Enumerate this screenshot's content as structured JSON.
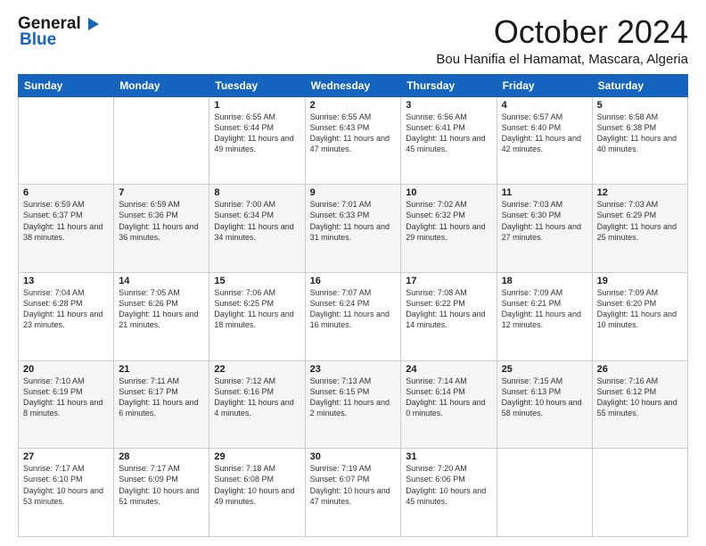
{
  "logo": {
    "general": "General",
    "blue": "Blue"
  },
  "header": {
    "month_title": "October 2024",
    "location": "Bou Hanifia el Hamamat, Mascara, Algeria"
  },
  "days_of_week": [
    "Sunday",
    "Monday",
    "Tuesday",
    "Wednesday",
    "Thursday",
    "Friday",
    "Saturday"
  ],
  "weeks": [
    [
      {
        "day": "",
        "sunrise": "",
        "sunset": "",
        "daylight": ""
      },
      {
        "day": "",
        "sunrise": "",
        "sunset": "",
        "daylight": ""
      },
      {
        "day": "1",
        "sunrise": "Sunrise: 6:55 AM",
        "sunset": "Sunset: 6:44 PM",
        "daylight": "Daylight: 11 hours and 49 minutes."
      },
      {
        "day": "2",
        "sunrise": "Sunrise: 6:55 AM",
        "sunset": "Sunset: 6:43 PM",
        "daylight": "Daylight: 11 hours and 47 minutes."
      },
      {
        "day": "3",
        "sunrise": "Sunrise: 6:56 AM",
        "sunset": "Sunset: 6:41 PM",
        "daylight": "Daylight: 11 hours and 45 minutes."
      },
      {
        "day": "4",
        "sunrise": "Sunrise: 6:57 AM",
        "sunset": "Sunset: 6:40 PM",
        "daylight": "Daylight: 11 hours and 42 minutes."
      },
      {
        "day": "5",
        "sunrise": "Sunrise: 6:58 AM",
        "sunset": "Sunset: 6:38 PM",
        "daylight": "Daylight: 11 hours and 40 minutes."
      }
    ],
    [
      {
        "day": "6",
        "sunrise": "Sunrise: 6:59 AM",
        "sunset": "Sunset: 6:37 PM",
        "daylight": "Daylight: 11 hours and 38 minutes."
      },
      {
        "day": "7",
        "sunrise": "Sunrise: 6:59 AM",
        "sunset": "Sunset: 6:36 PM",
        "daylight": "Daylight: 11 hours and 36 minutes."
      },
      {
        "day": "8",
        "sunrise": "Sunrise: 7:00 AM",
        "sunset": "Sunset: 6:34 PM",
        "daylight": "Daylight: 11 hours and 34 minutes."
      },
      {
        "day": "9",
        "sunrise": "Sunrise: 7:01 AM",
        "sunset": "Sunset: 6:33 PM",
        "daylight": "Daylight: 11 hours and 31 minutes."
      },
      {
        "day": "10",
        "sunrise": "Sunrise: 7:02 AM",
        "sunset": "Sunset: 6:32 PM",
        "daylight": "Daylight: 11 hours and 29 minutes."
      },
      {
        "day": "11",
        "sunrise": "Sunrise: 7:03 AM",
        "sunset": "Sunset: 6:30 PM",
        "daylight": "Daylight: 11 hours and 27 minutes."
      },
      {
        "day": "12",
        "sunrise": "Sunrise: 7:03 AM",
        "sunset": "Sunset: 6:29 PM",
        "daylight": "Daylight: 11 hours and 25 minutes."
      }
    ],
    [
      {
        "day": "13",
        "sunrise": "Sunrise: 7:04 AM",
        "sunset": "Sunset: 6:28 PM",
        "daylight": "Daylight: 11 hours and 23 minutes."
      },
      {
        "day": "14",
        "sunrise": "Sunrise: 7:05 AM",
        "sunset": "Sunset: 6:26 PM",
        "daylight": "Daylight: 11 hours and 21 minutes."
      },
      {
        "day": "15",
        "sunrise": "Sunrise: 7:06 AM",
        "sunset": "Sunset: 6:25 PM",
        "daylight": "Daylight: 11 hours and 18 minutes."
      },
      {
        "day": "16",
        "sunrise": "Sunrise: 7:07 AM",
        "sunset": "Sunset: 6:24 PM",
        "daylight": "Daylight: 11 hours and 16 minutes."
      },
      {
        "day": "17",
        "sunrise": "Sunrise: 7:08 AM",
        "sunset": "Sunset: 6:22 PM",
        "daylight": "Daylight: 11 hours and 14 minutes."
      },
      {
        "day": "18",
        "sunrise": "Sunrise: 7:09 AM",
        "sunset": "Sunset: 6:21 PM",
        "daylight": "Daylight: 11 hours and 12 minutes."
      },
      {
        "day": "19",
        "sunrise": "Sunrise: 7:09 AM",
        "sunset": "Sunset: 6:20 PM",
        "daylight": "Daylight: 11 hours and 10 minutes."
      }
    ],
    [
      {
        "day": "20",
        "sunrise": "Sunrise: 7:10 AM",
        "sunset": "Sunset: 6:19 PM",
        "daylight": "Daylight: 11 hours and 8 minutes."
      },
      {
        "day": "21",
        "sunrise": "Sunrise: 7:11 AM",
        "sunset": "Sunset: 6:17 PM",
        "daylight": "Daylight: 11 hours and 6 minutes."
      },
      {
        "day": "22",
        "sunrise": "Sunrise: 7:12 AM",
        "sunset": "Sunset: 6:16 PM",
        "daylight": "Daylight: 11 hours and 4 minutes."
      },
      {
        "day": "23",
        "sunrise": "Sunrise: 7:13 AM",
        "sunset": "Sunset: 6:15 PM",
        "daylight": "Daylight: 11 hours and 2 minutes."
      },
      {
        "day": "24",
        "sunrise": "Sunrise: 7:14 AM",
        "sunset": "Sunset: 6:14 PM",
        "daylight": "Daylight: 11 hours and 0 minutes."
      },
      {
        "day": "25",
        "sunrise": "Sunrise: 7:15 AM",
        "sunset": "Sunset: 6:13 PM",
        "daylight": "Daylight: 10 hours and 58 minutes."
      },
      {
        "day": "26",
        "sunrise": "Sunrise: 7:16 AM",
        "sunset": "Sunset: 6:12 PM",
        "daylight": "Daylight: 10 hours and 55 minutes."
      }
    ],
    [
      {
        "day": "27",
        "sunrise": "Sunrise: 7:17 AM",
        "sunset": "Sunset: 6:10 PM",
        "daylight": "Daylight: 10 hours and 53 minutes."
      },
      {
        "day": "28",
        "sunrise": "Sunrise: 7:17 AM",
        "sunset": "Sunset: 6:09 PM",
        "daylight": "Daylight: 10 hours and 51 minutes."
      },
      {
        "day": "29",
        "sunrise": "Sunrise: 7:18 AM",
        "sunset": "Sunset: 6:08 PM",
        "daylight": "Daylight: 10 hours and 49 minutes."
      },
      {
        "day": "30",
        "sunrise": "Sunrise: 7:19 AM",
        "sunset": "Sunset: 6:07 PM",
        "daylight": "Daylight: 10 hours and 47 minutes."
      },
      {
        "day": "31",
        "sunrise": "Sunrise: 7:20 AM",
        "sunset": "Sunset: 6:06 PM",
        "daylight": "Daylight: 10 hours and 45 minutes."
      },
      {
        "day": "",
        "sunrise": "",
        "sunset": "",
        "daylight": ""
      },
      {
        "day": "",
        "sunrise": "",
        "sunset": "",
        "daylight": ""
      }
    ]
  ]
}
